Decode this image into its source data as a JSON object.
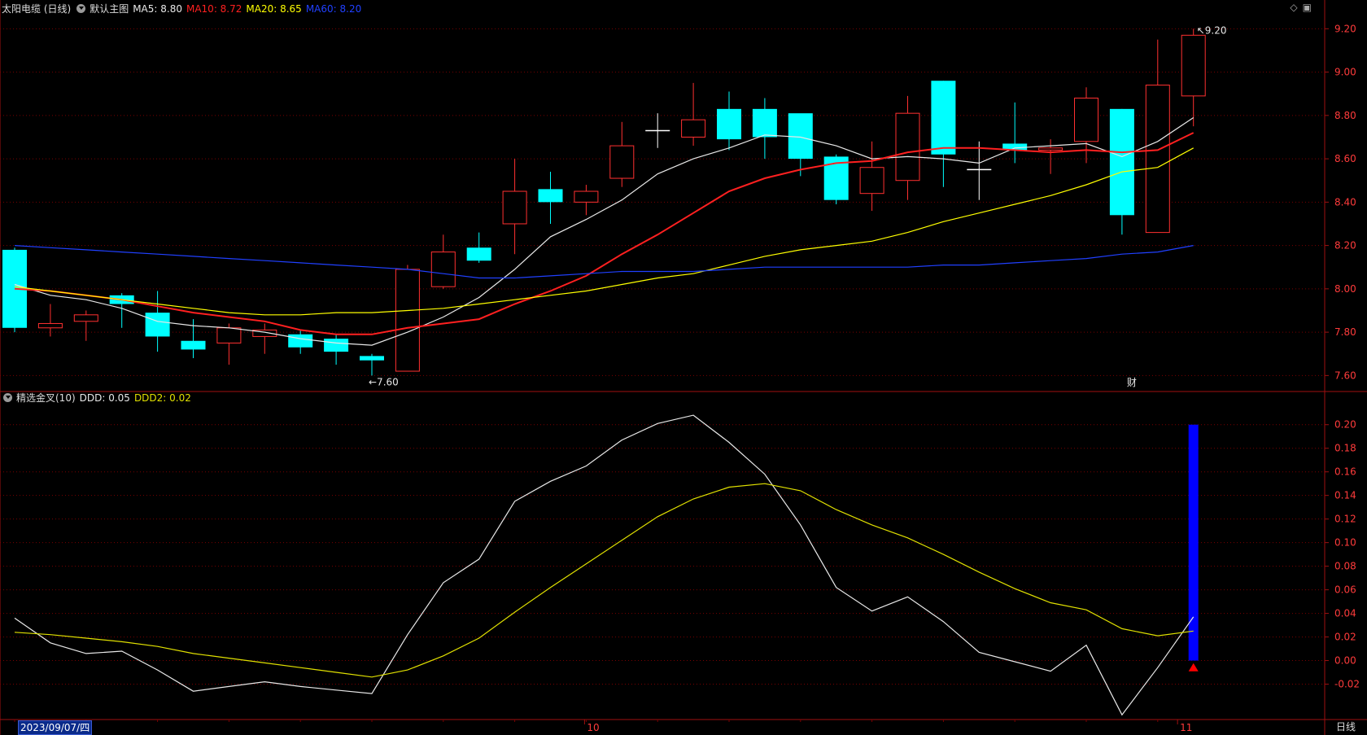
{
  "header": {
    "stock_name": "太阳电缆 (日线)",
    "main_chart_label": "默认主图",
    "ma": [
      {
        "label": "MA5: 8.80",
        "color": "#e8e8e8"
      },
      {
        "label": "MA10: 8.72",
        "color": "#ff2020"
      },
      {
        "label": "MA20: 8.65",
        "color": "#ffff00"
      },
      {
        "label": "MA60: 8.20",
        "color": "#2040ff"
      }
    ]
  },
  "indicator_header": {
    "name": "精选金叉(10)",
    "ddd_label": "DDD: 0.05",
    "ddd2_label": "DDD2: 0.02"
  },
  "corner_icons": [
    "diamond-icon",
    "lock-icon"
  ],
  "footer": {
    "date_selected": "2023/09/07/四",
    "period": "日线",
    "month_labels": [
      "10",
      "11"
    ]
  },
  "annotations": {
    "high": "9.20",
    "low": "7.60",
    "fin_marker": "财"
  },
  "colors": {
    "up": "#ff3030",
    "down": "#00ffff",
    "grid": "#7a0000",
    "axis": "#a01010",
    "tick_text": "#ff3b3b"
  },
  "chart_data": [
    {
      "type": "candlestick",
      "title": "太阳电缆 (日线)",
      "yticks": [
        "7.60",
        "7.80",
        "8.00",
        "8.20",
        "8.40",
        "8.60",
        "8.80",
        "9.00",
        "9.20"
      ],
      "ylim": [
        7.53,
        9.25
      ],
      "candles": [
        {
          "o": 8.18,
          "h": 8.19,
          "l": 7.8,
          "c": 7.82
        },
        {
          "o": 7.82,
          "h": 7.93,
          "l": 7.78,
          "c": 7.84
        },
        {
          "o": 7.85,
          "h": 7.9,
          "l": 7.76,
          "c": 7.88
        },
        {
          "o": 7.97,
          "h": 7.98,
          "l": 7.82,
          "c": 7.93
        },
        {
          "o": 7.89,
          "h": 7.99,
          "l": 7.71,
          "c": 7.78
        },
        {
          "o": 7.76,
          "h": 7.86,
          "l": 7.68,
          "c": 7.72
        },
        {
          "o": 7.75,
          "h": 7.84,
          "l": 7.65,
          "c": 7.82
        },
        {
          "o": 7.78,
          "h": 7.84,
          "l": 7.7,
          "c": 7.81
        },
        {
          "o": 7.79,
          "h": 7.81,
          "l": 7.7,
          "c": 7.73
        },
        {
          "o": 7.77,
          "h": 7.79,
          "l": 7.65,
          "c": 7.71
        },
        {
          "o": 7.69,
          "h": 7.7,
          "l": 7.6,
          "c": 7.67
        },
        {
          "o": 7.62,
          "h": 8.11,
          "l": 7.62,
          "c": 8.09
        },
        {
          "o": 8.01,
          "h": 8.25,
          "l": 8.0,
          "c": 8.17
        },
        {
          "o": 8.19,
          "h": 8.26,
          "l": 8.12,
          "c": 8.13
        },
        {
          "o": 8.3,
          "h": 8.6,
          "l": 8.16,
          "c": 8.45
        },
        {
          "o": 8.46,
          "h": 8.54,
          "l": 8.3,
          "c": 8.4
        },
        {
          "o": 8.4,
          "h": 8.48,
          "l": 8.34,
          "c": 8.45
        },
        {
          "o": 8.51,
          "h": 8.77,
          "l": 8.47,
          "c": 8.66
        },
        {
          "o": 8.73,
          "h": 8.81,
          "l": 8.65,
          "c": 8.73
        },
        {
          "o": 8.7,
          "h": 8.95,
          "l": 8.66,
          "c": 8.78
        },
        {
          "o": 8.83,
          "h": 8.91,
          "l": 8.64,
          "c": 8.69
        },
        {
          "o": 8.83,
          "h": 8.88,
          "l": 8.6,
          "c": 8.7
        },
        {
          "o": 8.81,
          "h": 8.8,
          "l": 8.52,
          "c": 8.6
        },
        {
          "o": 8.61,
          "h": 8.62,
          "l": 8.39,
          "c": 8.41
        },
        {
          "o": 8.44,
          "h": 8.68,
          "l": 8.36,
          "c": 8.56
        },
        {
          "o": 8.5,
          "h": 8.89,
          "l": 8.41,
          "c": 8.81
        },
        {
          "o": 8.96,
          "h": 8.96,
          "l": 8.47,
          "c": 8.62
        },
        {
          "o": 8.55,
          "h": 8.68,
          "l": 8.41,
          "c": 8.55
        },
        {
          "o": 8.67,
          "h": 8.86,
          "l": 8.58,
          "c": 8.64
        },
        {
          "o": 8.64,
          "h": 8.69,
          "l": 8.53,
          "c": 8.65
        },
        {
          "o": 8.68,
          "h": 8.93,
          "l": 8.58,
          "c": 8.88
        },
        {
          "o": 8.83,
          "h": 8.83,
          "l": 8.25,
          "c": 8.34
        },
        {
          "o": 8.26,
          "h": 9.15,
          "l": 8.26,
          "c": 8.94
        },
        {
          "o": 8.89,
          "h": 9.2,
          "l": 8.75,
          "c": 9.17
        }
      ],
      "series": [
        {
          "name": "MA5",
          "color": "#e8e8e8",
          "values": [
            8.02,
            7.97,
            7.95,
            7.91,
            7.85,
            7.83,
            7.82,
            7.8,
            7.77,
            7.75,
            7.74,
            7.8,
            7.87,
            7.96,
            8.09,
            8.24,
            8.32,
            8.41,
            8.53,
            8.6,
            8.65,
            8.71,
            8.7,
            8.66,
            8.6,
            8.61,
            8.6,
            8.58,
            8.65,
            8.66,
            8.67,
            8.61,
            8.68,
            8.79
          ]
        },
        {
          "name": "MA10",
          "color": "#ff2020",
          "values": [
            8.0,
            7.99,
            7.97,
            7.95,
            7.92,
            7.89,
            7.87,
            7.85,
            7.81,
            7.79,
            7.79,
            7.82,
            7.84,
            7.86,
            7.93,
            7.99,
            8.06,
            8.16,
            8.25,
            8.35,
            8.45,
            8.51,
            8.55,
            8.58,
            8.59,
            8.63,
            8.65,
            8.65,
            8.64,
            8.63,
            8.64,
            8.63,
            8.64,
            8.72
          ]
        },
        {
          "name": "MA20",
          "color": "#ffff00",
          "values": [
            8.01,
            7.99,
            7.97,
            7.95,
            7.93,
            7.91,
            7.89,
            7.88,
            7.88,
            7.89,
            7.89,
            7.9,
            7.91,
            7.93,
            7.95,
            7.97,
            7.99,
            8.02,
            8.05,
            8.07,
            8.11,
            8.15,
            8.18,
            8.2,
            8.22,
            8.26,
            8.31,
            8.35,
            8.39,
            8.43,
            8.48,
            8.54,
            8.56,
            8.65
          ]
        },
        {
          "name": "MA60",
          "color": "#2040ff",
          "values": [
            8.2,
            8.19,
            8.18,
            8.17,
            8.16,
            8.15,
            8.14,
            8.13,
            8.12,
            8.11,
            8.1,
            8.09,
            8.07,
            8.05,
            8.05,
            8.06,
            8.07,
            8.08,
            8.08,
            8.08,
            8.09,
            8.1,
            8.1,
            8.1,
            8.1,
            8.1,
            8.11,
            8.11,
            8.12,
            8.13,
            8.14,
            8.16,
            8.17,
            8.2
          ]
        }
      ]
    },
    {
      "type": "line",
      "title": "精选金叉(10)",
      "yticks": [
        "-0.02",
        "0.00",
        "0.02",
        "0.04",
        "0.06",
        "0.08",
        "0.10",
        "0.12",
        "0.14",
        "0.16",
        "0.18",
        "0.20"
      ],
      "ylim": [
        -0.05,
        0.215
      ],
      "series": [
        {
          "name": "DDD",
          "color": "#e8e8e8",
          "values": [
            0.036,
            0.015,
            0.006,
            0.008,
            -0.008,
            -0.026,
            -0.022,
            -0.018,
            -0.022,
            -0.025,
            -0.028,
            0.022,
            0.066,
            0.086,
            0.135,
            0.152,
            0.165,
            0.187,
            0.201,
            0.208,
            0.185,
            0.158,
            0.115,
            0.062,
            0.042,
            0.054,
            0.033,
            0.007,
            -0.001,
            -0.009,
            0.013,
            -0.046,
            -0.006,
            0.037
          ]
        },
        {
          "name": "DDD2",
          "color": "#e0e000",
          "values": [
            0.024,
            0.022,
            0.019,
            0.016,
            0.012,
            0.006,
            0.002,
            -0.002,
            -0.006,
            -0.01,
            -0.014,
            -0.008,
            0.004,
            0.019,
            0.041,
            0.062,
            0.082,
            0.102,
            0.122,
            0.137,
            0.147,
            0.15,
            0.144,
            0.128,
            0.115,
            0.104,
            0.09,
            0.075,
            0.061,
            0.049,
            0.043,
            0.027,
            0.021,
            0.025
          ]
        }
      ],
      "signal_bar": {
        "index": 33,
        "from": 0.0,
        "to": 0.2,
        "color": "#0000ff"
      },
      "signal_marker": {
        "index": 33,
        "value": -0.005,
        "color": "#ff0000"
      }
    }
  ]
}
